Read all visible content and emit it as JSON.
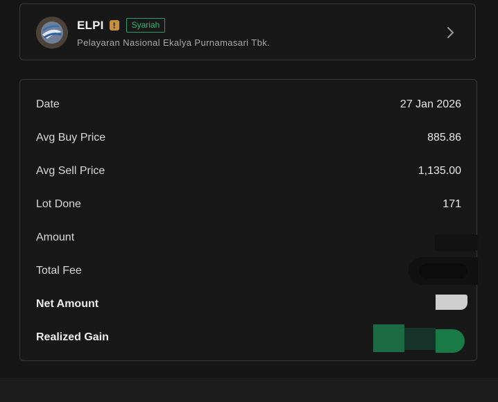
{
  "stock": {
    "ticker": "ELPI",
    "warning_symbol": "!",
    "badge": "Syariah",
    "company_name": "Pelayaran Nasional Ekalya Purnamasari Tbk.",
    "logo_icon": "ship-logo-icon",
    "chevron_icon": "chevron-right-icon"
  },
  "details": {
    "rows": [
      {
        "label": "Date",
        "value": "27 Jan 2026"
      },
      {
        "label": "Avg Buy Price",
        "value": "885.86"
      },
      {
        "label": "Avg Sell Price",
        "value": "1,135.00"
      },
      {
        "label": "Lot Done",
        "value": "171"
      },
      {
        "label": "Amount",
        "value": ""
      },
      {
        "label": "Total Fee",
        "value": ""
      },
      {
        "label": "Net Amount",
        "value": ""
      },
      {
        "label": "Realized Gain",
        "value": ""
      }
    ]
  },
  "colors": {
    "background": "#161616",
    "border": "#3a3a3a",
    "syariah_green": "#34b878",
    "warning": "#c6903a",
    "gain_green": "#1f7a4a"
  }
}
